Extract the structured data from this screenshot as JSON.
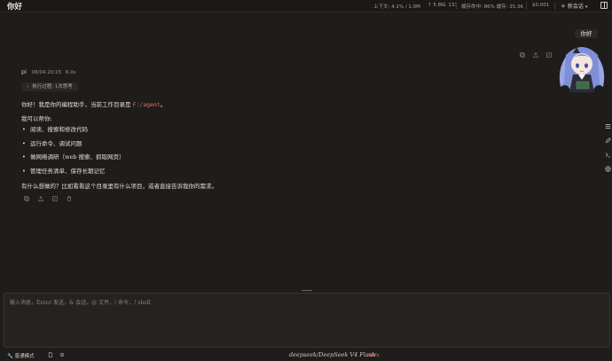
{
  "window": {
    "title": "你好"
  },
  "stats": {
    "context": "上下文: 4.1% / 1.0M",
    "tokens_up": "↑ 5.8K",
    "tokens_down": "↓ 131",
    "cache": "缓存命中: 86% 缓存: 35.3K",
    "cost": "$0.001"
  },
  "header": {
    "new_session": "新会话"
  },
  "user_message": {
    "text": "你好"
  },
  "assistant": {
    "name": "pi",
    "timestamp": "08/04 20:15",
    "duration": "6.0s",
    "exec_label": "执行过程: 1次思考",
    "greeting_prefix": "你好！我是你的编程助手，当前工作目录是",
    "working_dir": "F:/agent",
    "greeting_suffix": "。",
    "can_help": "我可以帮你:",
    "capabilities": [
      "阅读、搜索和修改代码",
      "运行命令、调试问题",
      "做网络调研（web 搜索、抓取网页）",
      "管理任务清单、保存长期记忆"
    ],
    "closing": "有什么想做的？比如看看这个目录里有什么项目，或者直接告诉我你的需求。"
  },
  "input": {
    "placeholder": "输入消息，Enter 发送，& 会话，@ 文件，/ 命令，! shell"
  },
  "footer": {
    "mode": "普通模式",
    "model": "deepseek/DeepSeek V4 Flash",
    "effort": "max"
  },
  "colors": {
    "background": "#1f1d1b",
    "accent": "#d9735e",
    "text": "#e0dcd6"
  }
}
